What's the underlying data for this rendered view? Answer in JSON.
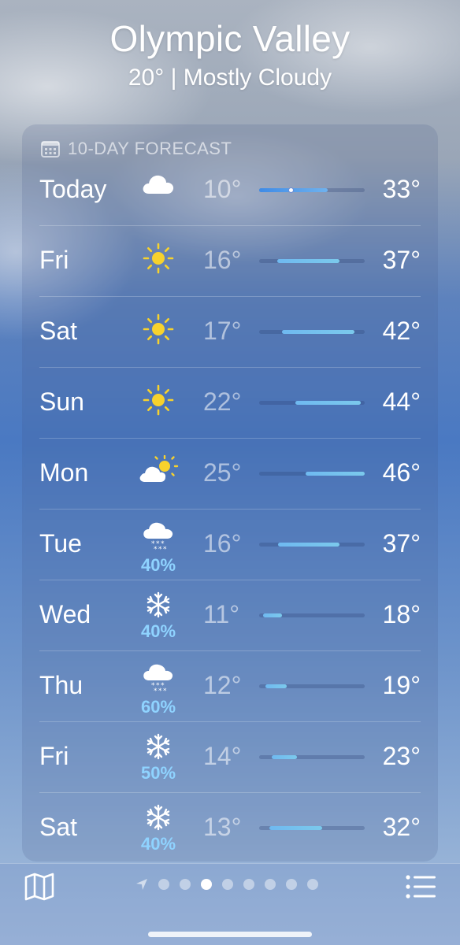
{
  "location": {
    "city": "Olympic Valley",
    "summary": "20° | Mostly Cloudy"
  },
  "forecast": {
    "title": "10-DAY FORECAST",
    "title_icon": "calendar-icon",
    "days": [
      {
        "day": "Today",
        "icon": "cloud-icon",
        "precip": "",
        "low": "10°",
        "high": "33°",
        "bar_start": 0.0,
        "bar_end": 0.65,
        "current": 0.3
      },
      {
        "day": "Fri",
        "icon": "sun-icon",
        "precip": "",
        "low": "16°",
        "high": "37°",
        "bar_start": 0.17,
        "bar_end": 0.76,
        "current": null
      },
      {
        "day": "Sat",
        "icon": "sun-icon",
        "precip": "",
        "low": "17°",
        "high": "42°",
        "bar_start": 0.22,
        "bar_end": 0.9,
        "current": null
      },
      {
        "day": "Sun",
        "icon": "sun-icon",
        "precip": "",
        "low": "22°",
        "high": "44°",
        "bar_start": 0.34,
        "bar_end": 0.96,
        "current": null
      },
      {
        "day": "Mon",
        "icon": "partly-sunny-icon",
        "precip": "",
        "low": "25°",
        "high": "46°",
        "bar_start": 0.44,
        "bar_end": 1.0,
        "current": null
      },
      {
        "day": "Tue",
        "icon": "snow-cloud-icon",
        "precip": "40%",
        "low": "16°",
        "high": "37°",
        "bar_start": 0.18,
        "bar_end": 0.76,
        "current": null
      },
      {
        "day": "Wed",
        "icon": "snowflake-icon",
        "precip": "40%",
        "low": "11°",
        "high": "18°",
        "bar_start": 0.04,
        "bar_end": 0.22,
        "current": null
      },
      {
        "day": "Thu",
        "icon": "snow-cloud-icon",
        "precip": "60%",
        "low": "12°",
        "high": "19°",
        "bar_start": 0.06,
        "bar_end": 0.26,
        "current": null
      },
      {
        "day": "Fri",
        "icon": "snowflake-icon",
        "precip": "50%",
        "low": "14°",
        "high": "23°",
        "bar_start": 0.12,
        "bar_end": 0.36,
        "current": null
      },
      {
        "day": "Sat",
        "icon": "snowflake-icon",
        "precip": "40%",
        "low": "13°",
        "high": "32°",
        "bar_start": 0.1,
        "bar_end": 0.6,
        "current": null
      }
    ]
  },
  "toolbar": {
    "map_icon": "map-icon",
    "list_icon": "list-icon",
    "location_icon": "location-arrow-icon",
    "page_count": 8,
    "active_page": 2
  },
  "colors": {
    "precip": "#8fd3ff",
    "bar": "#6fb9f0",
    "current_dot": "#ffffff"
  }
}
